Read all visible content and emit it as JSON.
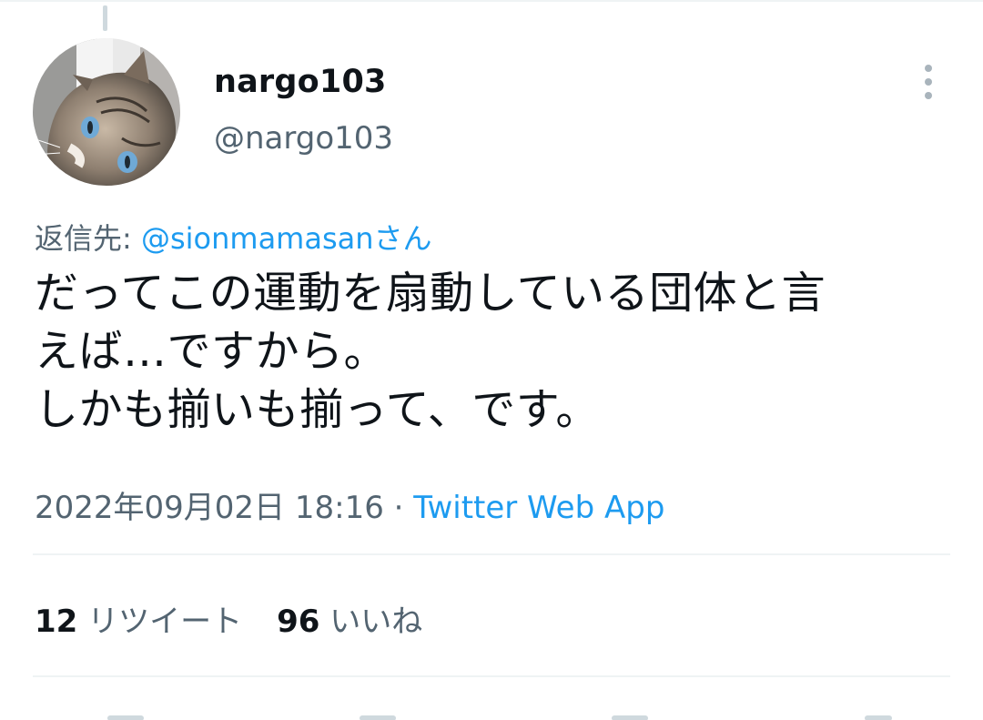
{
  "tweet": {
    "author": {
      "display_name": "nargo103",
      "handle": "@nargo103",
      "avatar_icon": "cat-avatar"
    },
    "more_icon": "more-vertical-icon",
    "reply_to": {
      "prefix": "返信先: ",
      "mention": "@sionmamasan",
      "suffix": "さん"
    },
    "text": "だってこの運動を扇動している団体と言\nえば…ですから。\nしかも揃いも揃って、です。",
    "timestamp": "2022年09月02日 18:16",
    "separator": " · ",
    "source": "Twitter Web App",
    "stats": {
      "retweets_count": "12",
      "retweets_label": "リツイート",
      "likes_count": "96",
      "likes_label": "いいね"
    }
  },
  "colors": {
    "text_primary": "#0f1419",
    "text_secondary": "#536471",
    "link": "#1d9bf0",
    "divider": "#eff3f4"
  }
}
